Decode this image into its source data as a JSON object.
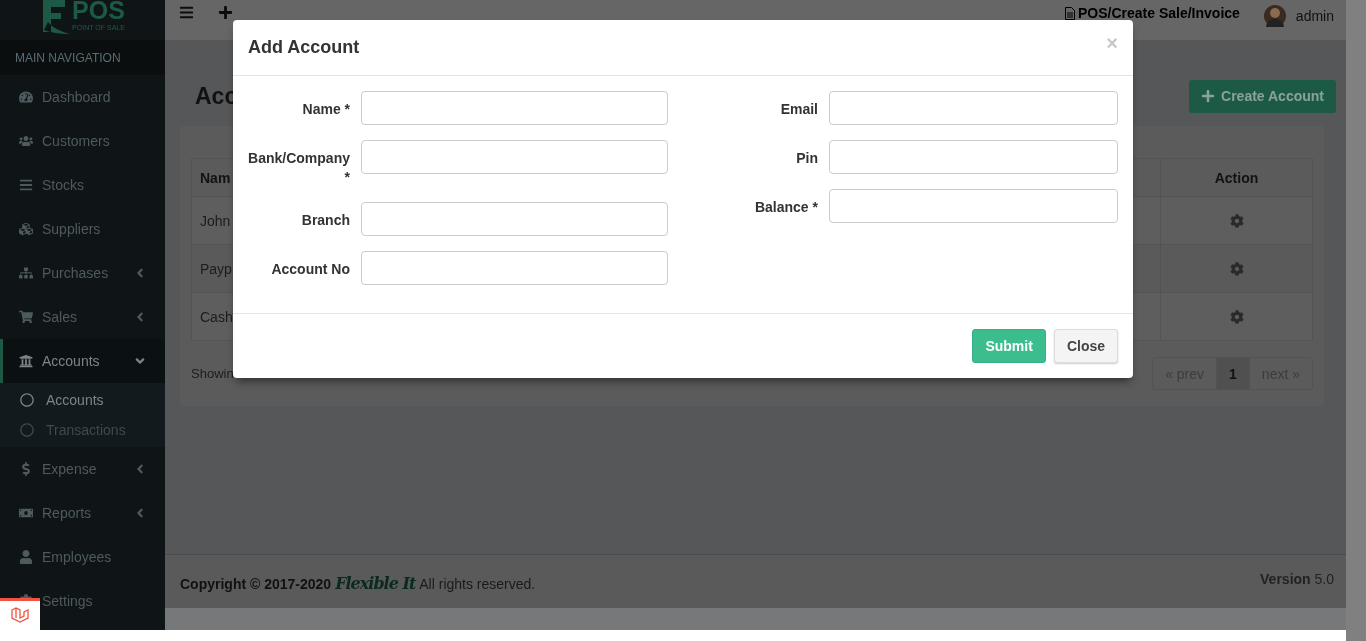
{
  "brand": {
    "logo_text": "POS",
    "tagline": "POINT OF SALE"
  },
  "sidebar": {
    "header": "MAIN NAVIGATION",
    "items": [
      {
        "label": "Dashboard",
        "kind": "link",
        "selected": false
      },
      {
        "label": "Customers",
        "kind": "link",
        "selected": false
      },
      {
        "label": "Stocks",
        "kind": "link",
        "selected": false
      },
      {
        "label": "Suppliers",
        "kind": "link",
        "selected": false
      },
      {
        "label": "Purchases",
        "kind": "menu",
        "expanded": false,
        "selected": false
      },
      {
        "label": "Sales",
        "kind": "menu",
        "expanded": false,
        "selected": false
      },
      {
        "label": "Accounts",
        "kind": "menu",
        "expanded": true,
        "selected": true,
        "children": [
          {
            "label": "Accounts",
            "selected": true
          },
          {
            "label": "Transactions",
            "selected": false
          }
        ]
      },
      {
        "label": "Expense",
        "kind": "menu",
        "expanded": false,
        "selected": false
      },
      {
        "label": "Reports",
        "kind": "menu",
        "expanded": false,
        "selected": false
      },
      {
        "label": "Employees",
        "kind": "link",
        "selected": false
      },
      {
        "label": "Settings",
        "kind": "link",
        "selected": false
      }
    ]
  },
  "topbar": {
    "breadcrumb": "POS/Create Sale/Invoice",
    "user": "admin"
  },
  "page": {
    "title": "Acc",
    "create_button": "Create Account",
    "table": {
      "columns": [
        "Nam",
        "Action"
      ],
      "rows": [
        [
          "John"
        ],
        [
          "Payp"
        ],
        [
          "Cash"
        ]
      ]
    },
    "showing": "Showin",
    "pagination": [
      {
        "label": "« prev",
        "selected": false
      },
      {
        "label": "1",
        "selected": true
      },
      {
        "label": "next »",
        "selected": false
      }
    ]
  },
  "footer": {
    "copyright": "Copyright © 2017-2020",
    "logo_text": "Flexible It",
    "rights": "All rights reserved.",
    "version_label": "Version",
    "version": "5.0"
  },
  "modal": {
    "title": "Add Account",
    "close_glyph": "×",
    "left_fields": [
      {
        "label": "Name *"
      },
      {
        "label": "Bank/Company *"
      },
      {
        "label": "Branch"
      },
      {
        "label": "Account No"
      }
    ],
    "right_fields": [
      {
        "label": "Email"
      },
      {
        "label": "Pin"
      },
      {
        "label": "Balance *"
      }
    ],
    "buttons": [
      {
        "label": "Submit",
        "kind": "primary"
      },
      {
        "label": "Close",
        "kind": "default"
      }
    ]
  }
}
